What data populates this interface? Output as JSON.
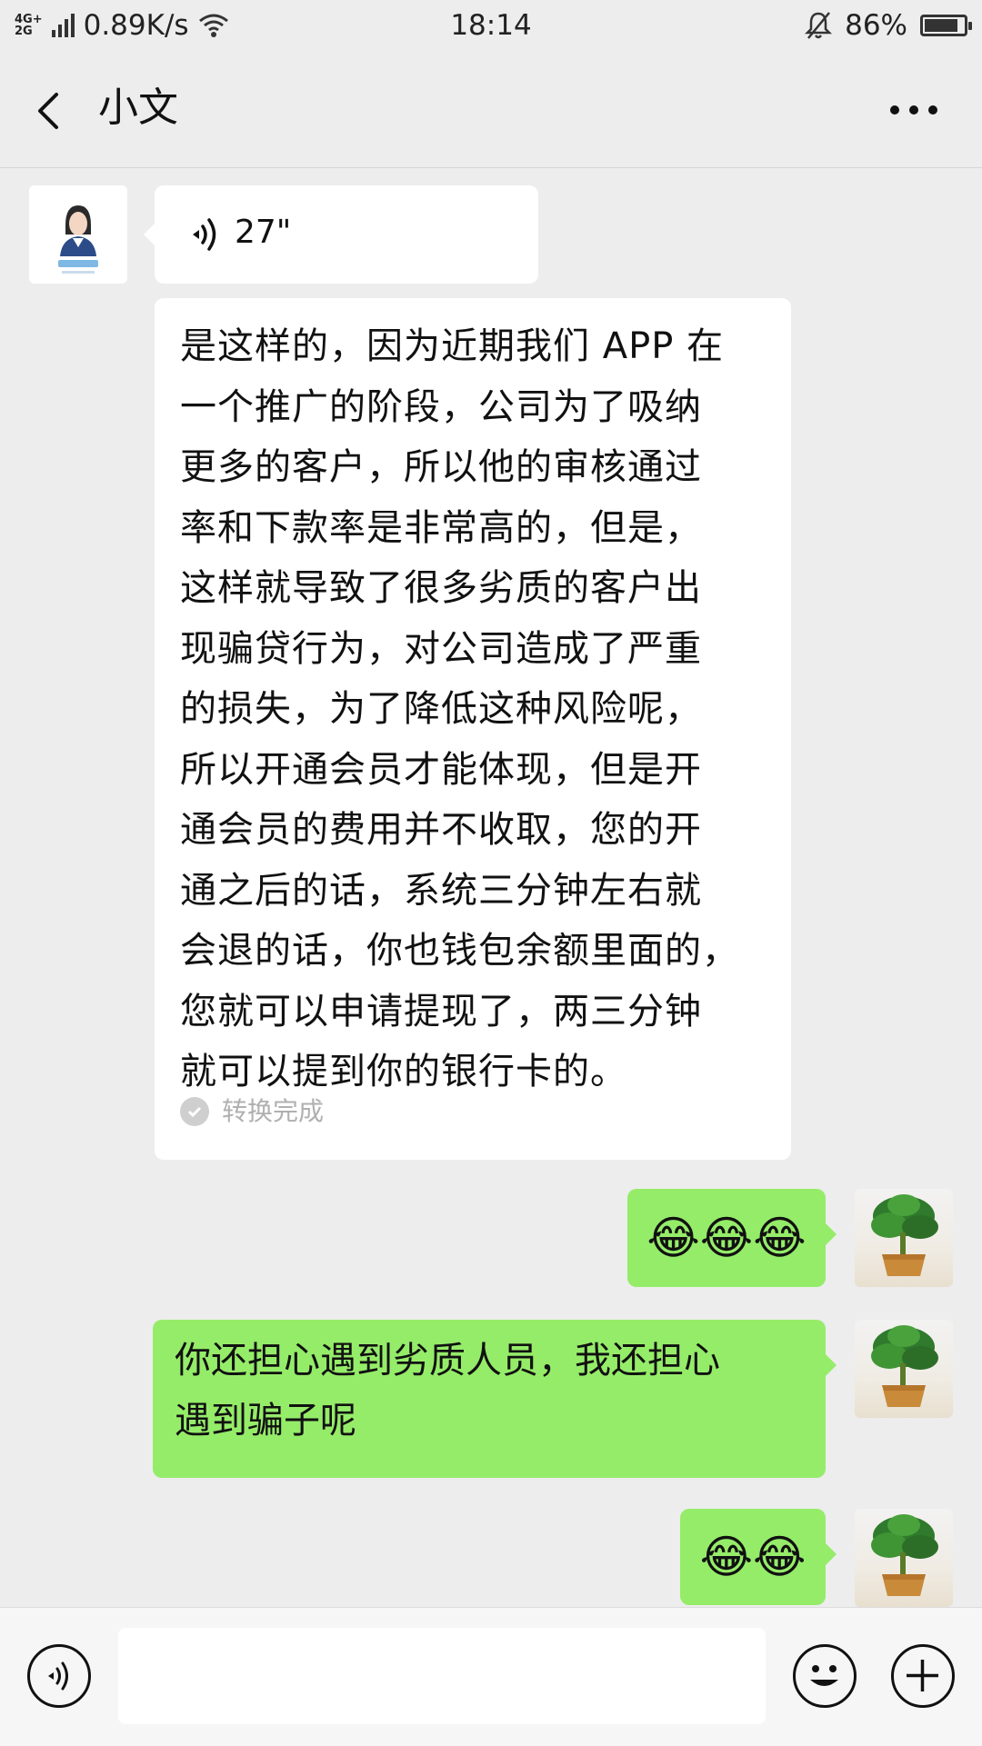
{
  "status_bar": {
    "network_top": "4G+",
    "network_bottom": "2G",
    "speed": "0.89K/s",
    "time": "18:14",
    "battery_percent": "86%",
    "battery_level": 0.86,
    "icons": [
      "signal-icon",
      "wifi-icon",
      "bell-muted-icon",
      "battery-icon"
    ]
  },
  "nav": {
    "title": "小文",
    "back_icon": "chevron-left-icon",
    "more_icon": "more-dots-icon"
  },
  "messages": [
    {
      "sender": "contact",
      "type": "voice",
      "duration": "27\""
    },
    {
      "sender": "contact",
      "type": "transcript",
      "lines": [
        "是这样的，因为近期我们 APP 在",
        "一个推广的阶段，公司为了吸纳",
        "更多的客户，所以他的审核通过",
        "率和下款率是非常高的，但是，",
        "这样就导致了很多劣质的客户出",
        "现骗贷行为，对公司造成了严重",
        "的损失，为了降低这种风险呢，",
        "所以开通会员才能体现，但是开",
        "通会员的费用并不收取，您的开",
        "通之后的话，系统三分钟左右就",
        "会退的话，你也钱包余额里面的，",
        "您就可以申请提现了，两三分钟",
        "就可以提到你的银行卡的。"
      ],
      "status": "转换完成"
    },
    {
      "sender": "me",
      "type": "emoji",
      "emoji": "😂😂😂"
    },
    {
      "sender": "me",
      "type": "text",
      "lines": [
        "你还担心遇到劣质人员，我还担心",
        "遇到骗子呢"
      ]
    },
    {
      "sender": "me",
      "type": "emoji",
      "emoji": "😂😂"
    }
  ],
  "input_bar": {
    "voice_icon": "voice-input-icon",
    "emoji_icon": "smiley-icon",
    "plus_icon": "plus-icon"
  },
  "colors": {
    "background": "#ededed",
    "outgoing_bubble": "#95ec69",
    "incoming_bubble": "#ffffff"
  }
}
